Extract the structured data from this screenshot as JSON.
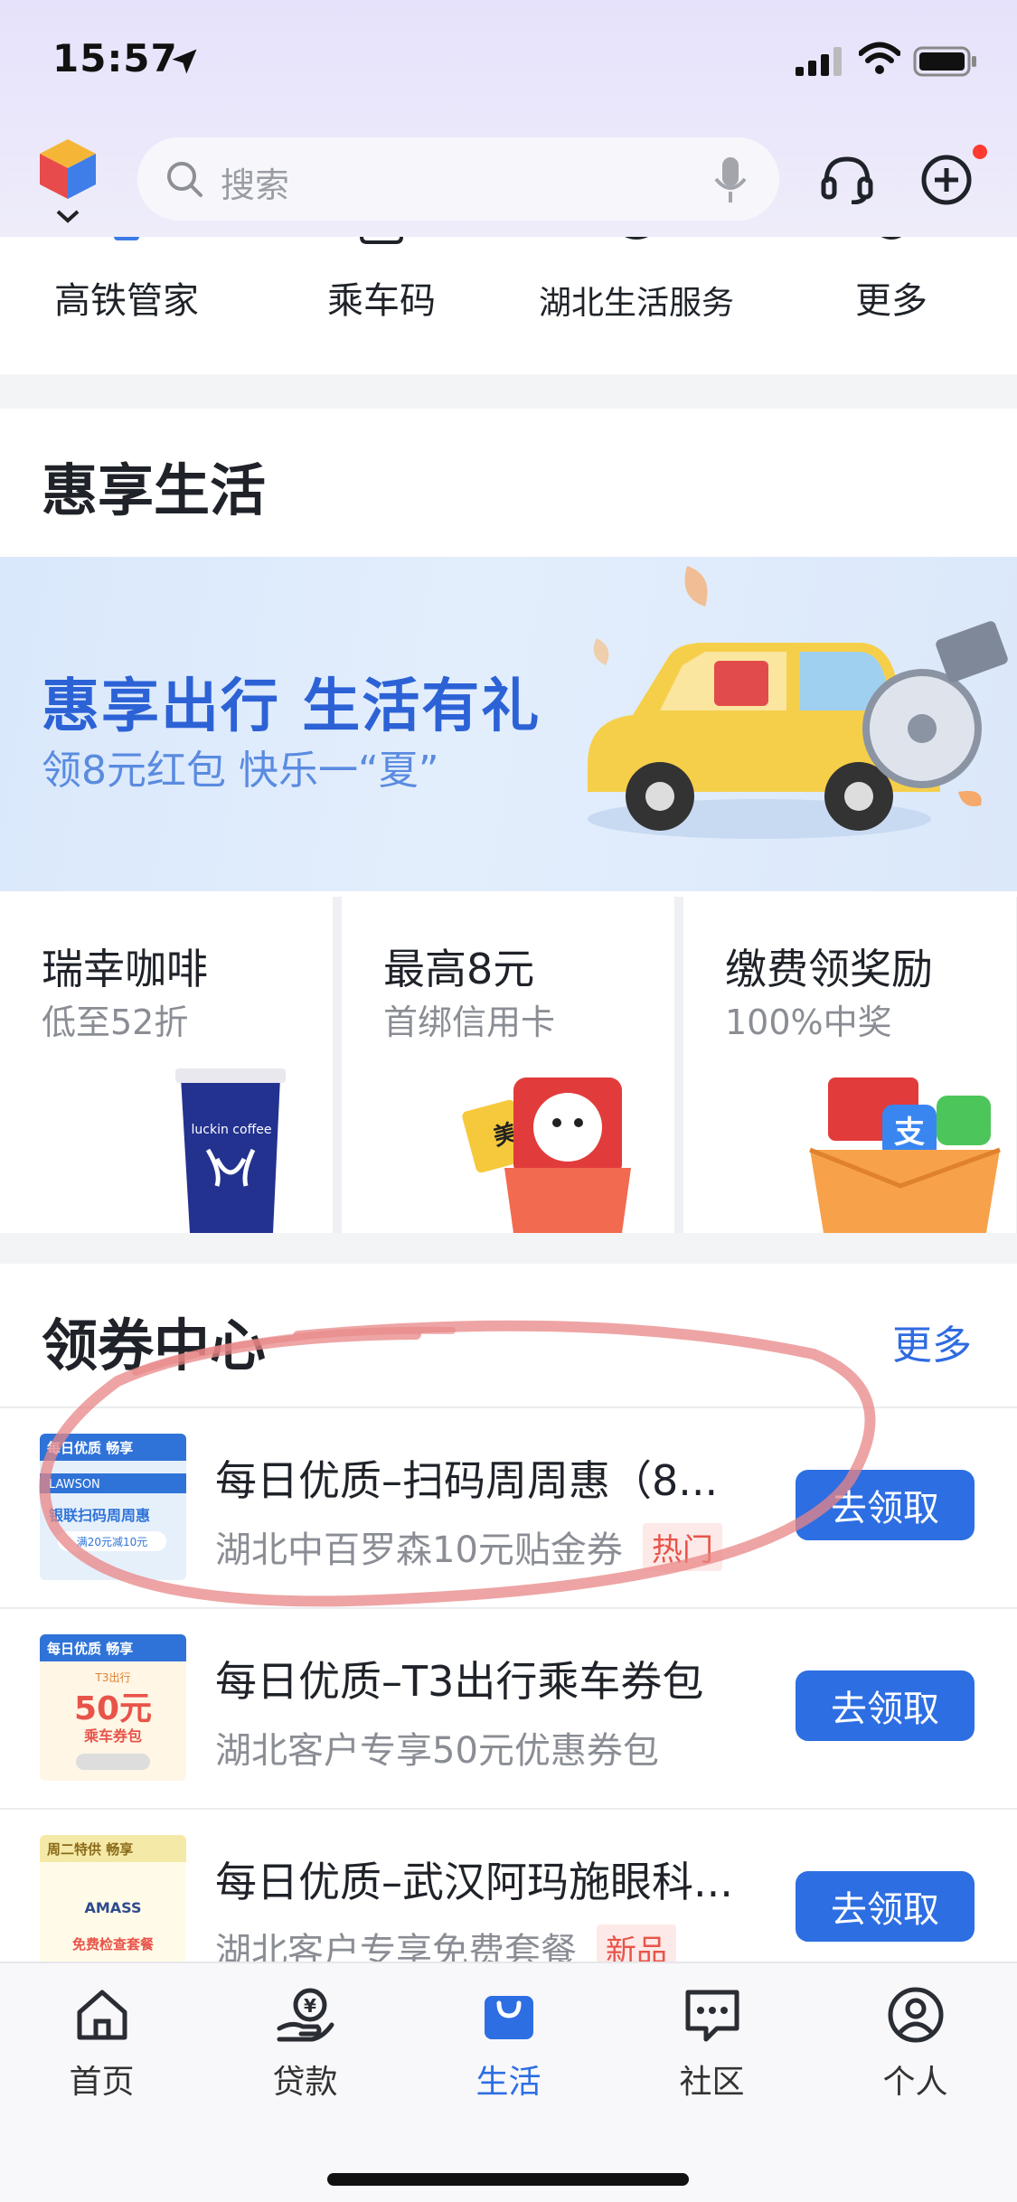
{
  "status_bar": {
    "time": "15:57"
  },
  "search": {
    "placeholder": "搜索"
  },
  "quick_services": [
    {
      "label": "高铁管家"
    },
    {
      "label": "乘车码"
    },
    {
      "label": "湖北生活服务"
    },
    {
      "label": "更多"
    }
  ],
  "life_section": {
    "title": "惠享生活",
    "banner": {
      "title": "惠享出行 生活有礼",
      "subtitle": "领8元红包 快乐一“夏”"
    },
    "promos": [
      {
        "title": "瑞幸咖啡",
        "subtitle": "低至52折",
        "art_text": "luckin coffee"
      },
      {
        "title": "最高8元",
        "subtitle": "首绑信用卡",
        "art_text": "美团"
      },
      {
        "title": "缴费领奖励",
        "subtitle": "100%中奖",
        "art_text": "支"
      }
    ]
  },
  "coupon_section": {
    "title": "领券中心",
    "more_label": "更多",
    "items": [
      {
        "name": "每日优质–扫码周周惠（8...",
        "desc": "湖北中百罗森10元贴金券",
        "tag": "热门",
        "button": "去领取",
        "thumb": {
          "top": "每日优质 畅享",
          "brand": "LAWSON",
          "main": "银联扫码周周惠",
          "foot": "满20元减10元"
        }
      },
      {
        "name": "每日优质–T3出行乘车券包",
        "desc": "湖北客户专享50元优惠券包",
        "tag": "",
        "button": "去领取",
        "thumb": {
          "top": "每日优质 畅享",
          "brand": "T3出行",
          "main": "50元",
          "foot": "乘车券包"
        }
      },
      {
        "name": "每日优质–武汉阿玛施眼科...",
        "desc": "湖北客户专享免费套餐",
        "tag": "新品",
        "button": "去领取",
        "thumb": {
          "top": "周二特供 畅享",
          "brand": "AMASS",
          "main": "",
          "foot": "免费检查套餐"
        }
      }
    ]
  },
  "tabbar": {
    "tabs": [
      {
        "label": "首页",
        "icon": "home-icon"
      },
      {
        "label": "贷款",
        "icon": "loan-icon"
      },
      {
        "label": "生活",
        "icon": "life-bag-icon",
        "active": true
      },
      {
        "label": "社区",
        "icon": "community-chat-icon"
      },
      {
        "label": "个人",
        "icon": "profile-icon"
      }
    ]
  },
  "colors": {
    "accent": "#2d6ee3",
    "tag_red": "#e8544a",
    "header_bg": "#e8e5fb"
  }
}
